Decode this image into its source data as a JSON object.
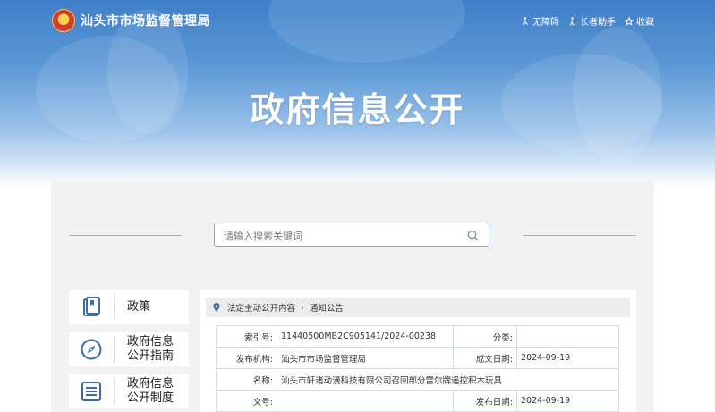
{
  "header": {
    "site_name": "汕头市市场监督管理局",
    "links": [
      "无障碍",
      "长者助手",
      "收藏"
    ],
    "hero_title": "政府信息公开"
  },
  "search": {
    "placeholder": "请输入搜索关键词"
  },
  "sidebar": {
    "items": [
      {
        "label": "政策",
        "icon": "policy-book-icon"
      },
      {
        "label": "政府信息\n公开指南",
        "icon": "compass-icon"
      },
      {
        "label": "政府信息\n公开制度",
        "icon": "document-list-icon"
      }
    ]
  },
  "breadcrumb": {
    "items": [
      "法定主动公开内容",
      "通知公告"
    ]
  },
  "info": {
    "index_label": "索引号:",
    "index_value": "11440500MB2C905141/2024-00238",
    "category_label": "分类:",
    "category_value": "",
    "publisher_label": "发布机构:",
    "publisher_value": "汕头市市场监督管理局",
    "created_label": "成文日期:",
    "created_value": "2024-09-19",
    "name_label": "名称:",
    "name_value": "汕头市轩诸动漫科技有限公司召回部分雷尔牌遥控积木玩具",
    "docno_label": "文号:",
    "docno_value": "",
    "pubdate_label": "发布日期:",
    "pubdate_value": "2024-09-19"
  },
  "colors": {
    "banner_blue": "#3f7fc9",
    "accent_line": "#8fb4df",
    "panel_bg": "#f2f2f2"
  }
}
